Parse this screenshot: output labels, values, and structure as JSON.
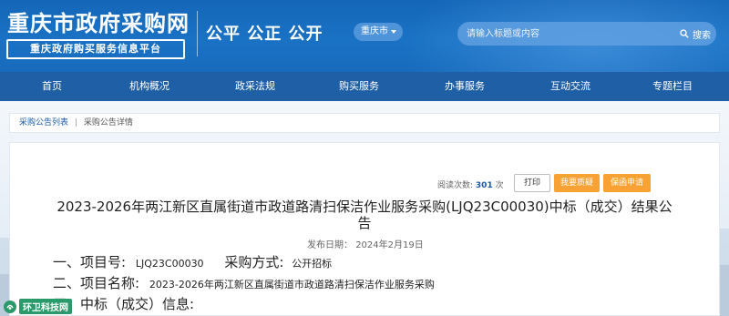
{
  "header": {
    "site_title": "重庆市政府采购网",
    "site_subtitle": "重庆政府购买服务信息平台",
    "slogan": "公平 公正 公开",
    "city_selector": "重庆市",
    "search": {
      "placeholder": "请输入标题或内容",
      "button_label": "搜索"
    },
    "colors": {
      "brand_blue": "#1466b8",
      "nav_blue": "#1f5fa5",
      "accent_orange": "#f7a233"
    }
  },
  "nav": {
    "items": [
      {
        "label": "首页"
      },
      {
        "label": "机构概况"
      },
      {
        "label": "政采法规"
      },
      {
        "label": "购买服务"
      },
      {
        "label": "办事服务"
      },
      {
        "label": "互动交流"
      },
      {
        "label": "专题栏目"
      }
    ]
  },
  "breadcrumb": {
    "items": [
      "采购公告列表",
      "采购公告详情"
    ],
    "separator": "|"
  },
  "article": {
    "view_count_label": "阅读次数:",
    "view_count": "301",
    "view_count_unit": "次",
    "print_button": "打印",
    "complain_button": "我要质疑",
    "protect_button": "保函申请",
    "title": "2023-2026年两江新区直属街道市政道路清扫保洁作业服务采购(LJQ23C00030)中标（成交）结果公告",
    "publish_date_label": "发布日期：",
    "publish_date": "2024年2月19日",
    "items": [
      {
        "prefix": "一、",
        "label": "项目号:",
        "value": "LJQ23C00030",
        "extra_label": "采购方式:",
        "extra_value": "公开招标"
      },
      {
        "prefix": "二、",
        "label": "项目名称:",
        "value": "2023-2026年两江新区直属街道市政道路清扫保洁作业服务采购"
      },
      {
        "prefix": "三、",
        "label": "中标（成交）信息:"
      }
    ]
  },
  "watermark": {
    "text": "环卫科技网"
  }
}
